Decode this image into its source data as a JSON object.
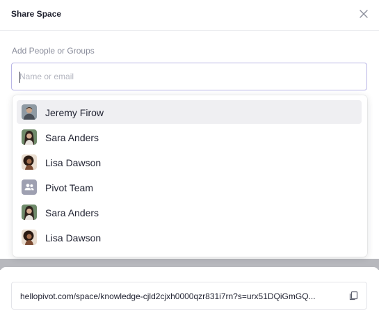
{
  "header": {
    "title": "Share Space"
  },
  "icons": {
    "close": "close-icon",
    "copy": "copy-icon",
    "team": "users-icon"
  },
  "add_people": {
    "label": "Add People or Groups",
    "input_placeholder": "Name or email",
    "input_value": ""
  },
  "suggestions": [
    {
      "name": "Jeremy Firow",
      "kind": "person",
      "highlighted": true
    },
    {
      "name": "Sara Anders",
      "kind": "person",
      "highlighted": false
    },
    {
      "name": "Lisa Dawson",
      "kind": "person",
      "highlighted": false
    },
    {
      "name": "Pivot Team",
      "kind": "group",
      "highlighted": false
    },
    {
      "name": "Sara Anders",
      "kind": "person",
      "highlighted": false
    },
    {
      "name": "Lisa Dawson",
      "kind": "person",
      "highlighted": false
    }
  ],
  "share_link": {
    "url": "hellopivot.com/space/knowledge-cjld2cjxh0000qzr831i7rn?s=urx51DQiGmGQ..."
  },
  "colors": {
    "input_border": "#b9b6e6",
    "highlight_row": "#efeff2",
    "group_avatar_bg": "#9ea0b1"
  }
}
